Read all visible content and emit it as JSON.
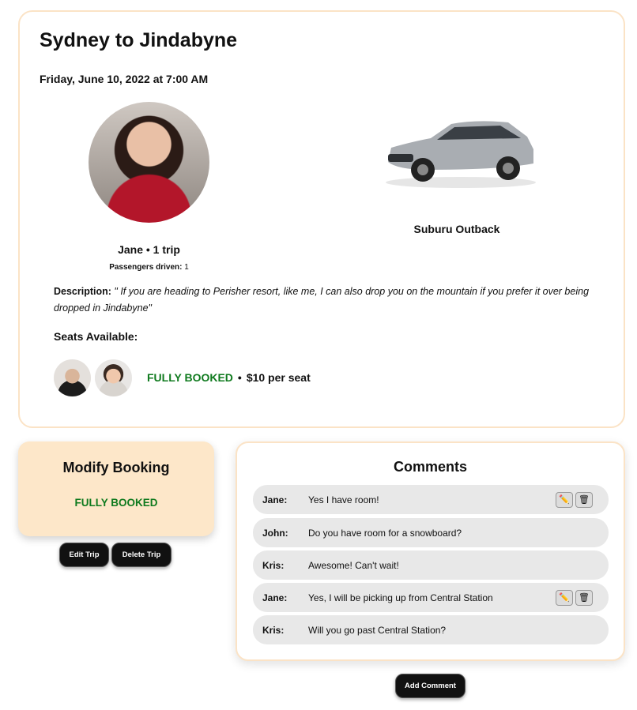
{
  "trip": {
    "title": "Sydney to Jindabyne",
    "datetime": "Friday, June 10, 2022 at 7:00 AM",
    "driver_name_line": "Jane  •  1 trip",
    "passengers_driven_label": "Passengers driven:",
    "passengers_driven_value": "1",
    "car_name": "Suburu Outback",
    "description_label": "Description:",
    "description_text": "\" If you are heading to Perisher resort, like me, I can also drop you on the mountain if you prefer it over being dropped in Jindabyne\"",
    "seats_label": "Seats Available:",
    "seats_status": "FULLY BOOKED",
    "seats_separator": "•",
    "seat_price": "$10 per seat"
  },
  "modify_booking": {
    "title": "Modify Booking",
    "status": "FULLY BOOKED",
    "edit_label": "Edit Trip",
    "delete_label": "Delete Trip"
  },
  "comments": {
    "title": "Comments",
    "items": [
      {
        "author": "Jane:",
        "text": "Yes I have room!"
      },
      {
        "author": "John:",
        "text": "Do you have room for a snowboard?"
      },
      {
        "author": "Kris:",
        "text": "Awesome! Can't wait!"
      },
      {
        "author": "Jane:",
        "text": "Yes, I will be picking up from Central Station"
      },
      {
        "author": "Kris:",
        "text": "Will you go past Central Station?"
      }
    ],
    "add_label": "Add Comment"
  },
  "icons": {
    "edit": "pencil-icon",
    "delete": "trash-icon"
  },
  "colors": {
    "status_green": "#0f7a1e",
    "card_border": "#fbe3c6",
    "modify_bg": "#fde7c9"
  }
}
